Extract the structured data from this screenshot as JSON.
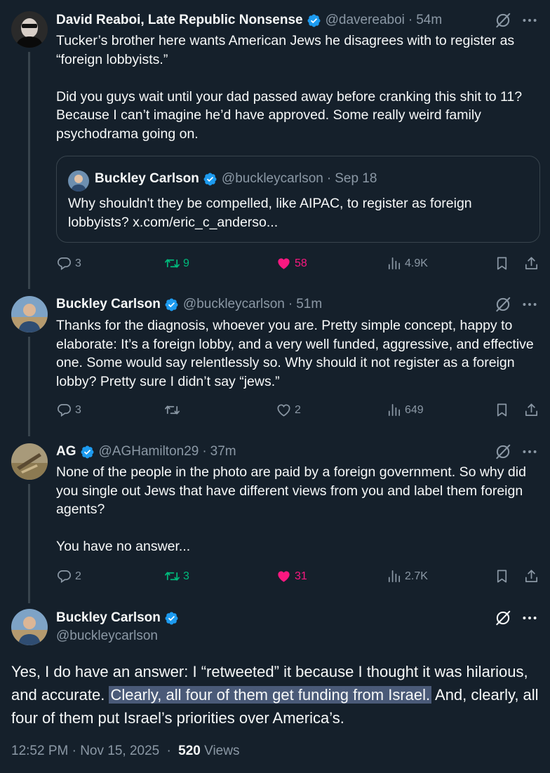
{
  "tweet1": {
    "name": "David Reaboi, Late Republic Nonsense",
    "handle": "@davereaboi",
    "time": "54m",
    "para1": "Tucker’s brother here wants American Jews he disagrees with to register as “foreign lobbyists.”",
    "para2": "Did you guys wait until your dad passed away before cranking this shit to 11? Because I can’t imagine he’d have approved. Some really weird family psychodrama going on.",
    "quote": {
      "name": "Buckley Carlson",
      "handle": "@buckleycarlson",
      "date": "Sep 18",
      "text": "Why shouldn't they be compelled, like AIPAC, to register as foreign lobbyists? x.com/eric_c_anderso..."
    },
    "replies": "3",
    "reposts": "9",
    "likes": "58",
    "views": "4.9K"
  },
  "tweet2": {
    "name": "Buckley Carlson",
    "handle": "@buckleycarlson",
    "time": "51m",
    "text": "Thanks for the diagnosis, whoever you are. Pretty simple concept, happy to elaborate: It’s a foreign lobby, and a very well funded, aggressive, and effective one. Some would say relentlessly so. Why should it not register as a foreign lobby? Pretty sure I didn’t say “jews.”",
    "replies": "3",
    "reposts": "",
    "likes": "2",
    "views": "649"
  },
  "tweet3": {
    "name": "AG",
    "handle": "@AGHamilton29",
    "time": "37m",
    "para1": "None of the people in the photo are paid by a foreign government. So why did you single out Jews that have different views from you and label them foreign agents?",
    "para2": "You have no answer...",
    "replies": "2",
    "reposts": "3",
    "likes": "31",
    "views": "2.7K"
  },
  "main": {
    "name": "Buckley Carlson",
    "handle": "@buckleycarlson",
    "text_before": "Yes, I do have an answer: I “retweeted” it because I thought it was hilarious, and accurate. ",
    "text_highlight": "Clearly, all four of them get funding from Israel.",
    "text_after": " And, clearly, all four of them put Israel’s priorities over America’s.",
    "timestamp": "12:52 PM · Nov 15, 2025",
    "views_count": "520",
    "views_label": "Views"
  },
  "separator": "·",
  "icons": {
    "verified": "verified-badge-icon",
    "grok": "grok-icon",
    "more": "more-icon",
    "reply": "reply-icon",
    "repost": "repost-icon",
    "like": "heart-icon",
    "views": "views-icon",
    "bookmark": "bookmark-icon",
    "share": "share-icon"
  },
  "colors": {
    "background": "#15202b",
    "text": "#f7f9f9",
    "secondary": "#8b98a5",
    "verified": "#1d9bf0",
    "repost_active": "#00ba7c",
    "like_active": "#f91880",
    "highlight": "#4a5a78"
  }
}
